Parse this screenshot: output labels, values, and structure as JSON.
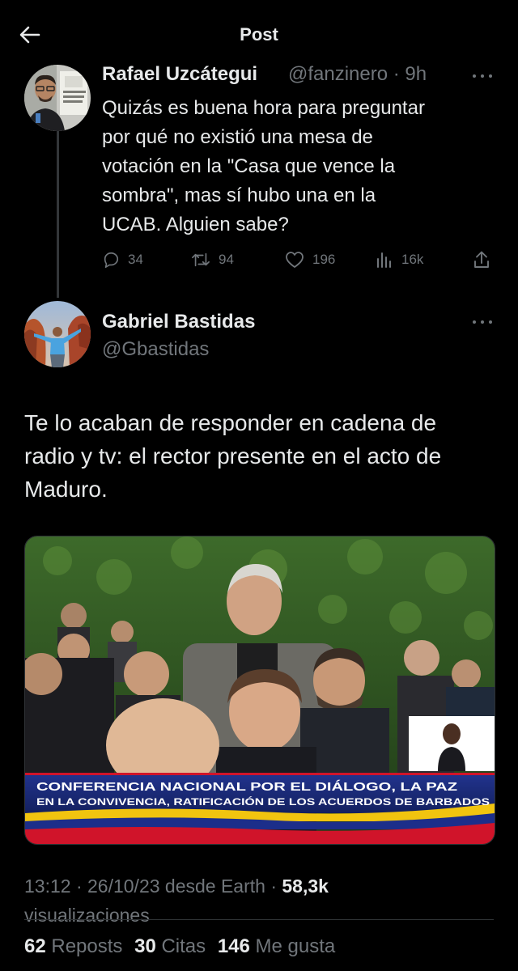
{
  "header": {
    "title": "Post"
  },
  "tweet1": {
    "name": "Rafael Uzcátegui",
    "handle_time": "@fanzinero · 9h",
    "lines": [
      "Quizás es buena hora para preguntar",
      "por qué no existió una mesa de",
      "votación en la \"Casa que vence la",
      "sombra\", mas sí hubo una en la",
      "UCAB. Alguien sabe?"
    ],
    "replies": "34",
    "reposts": "94",
    "likes": "196",
    "views": "16k"
  },
  "tweet2": {
    "name": "Gabriel Bastidas",
    "handle": "@Gbastidas",
    "lines": [
      "Te lo acaban de responder en cadena de",
      "radio y tv: el rector presente en el acto de",
      "Maduro."
    ],
    "media": {
      "banner_line1": "CONFERENCIA NACIONAL POR EL DIÁLOGO, LA PAZ",
      "banner_line2": "EN LA CONVIVENCIA, RATIFICACIÓN DE LOS ACUERDOS DE BARBADOS"
    },
    "timestamp": "13:12 · 26/10/23 desde Earth · ",
    "views_count": "58,3k",
    "views_label": "visualizaciones",
    "stats": {
      "reposts_count": "62",
      "reposts_label": "Reposts",
      "quotes_count": "30",
      "quotes_label": "Citas",
      "likes_count": "146",
      "likes_label": "Me gusta"
    }
  },
  "colors": {
    "background": "#000000",
    "text": "#e7e9ea",
    "muted": "#71767b",
    "banner_red": "#d0142a",
    "banner_blue": "#1c2e8a"
  }
}
